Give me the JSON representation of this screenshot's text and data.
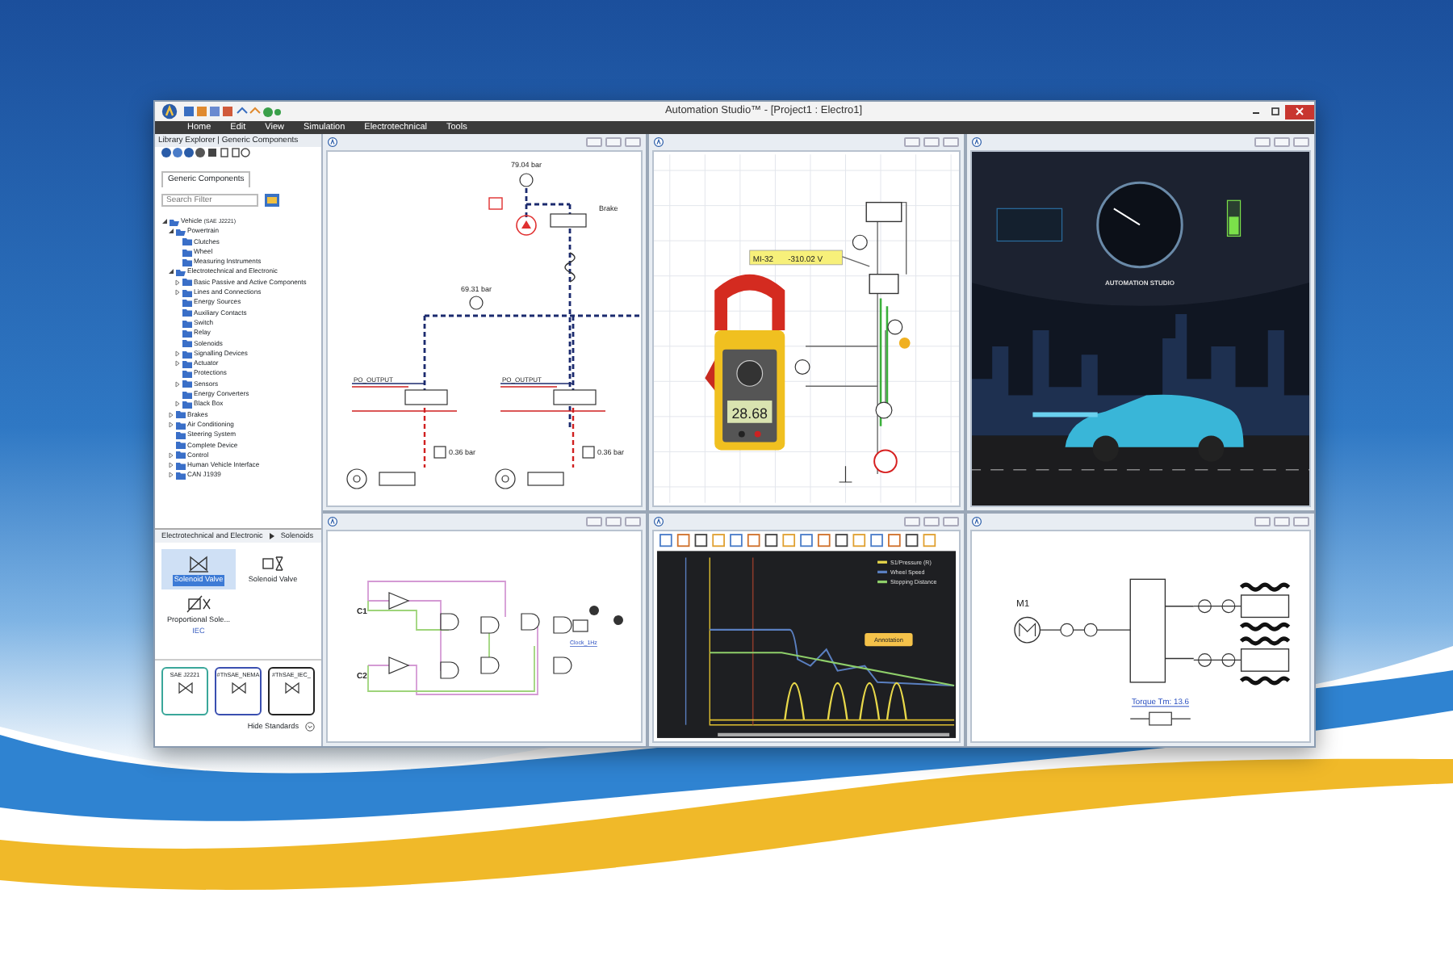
{
  "window": {
    "title": "Automation Studio™ - [Project1 : Electro1]"
  },
  "menu": [
    "Home",
    "Edit",
    "View",
    "Simulation",
    "Electrotechnical",
    "Tools"
  ],
  "library": {
    "title": "Library Explorer | Generic Components",
    "tab": "Generic Components",
    "search": {
      "placeholder": "Search Filter"
    },
    "tree": [
      {
        "label": "Vehicle",
        "note": "(SAE J2221)",
        "expanded": true,
        "children": [
          {
            "label": "Powertrain",
            "expanded": true,
            "children": [
              {
                "label": "Clutches"
              },
              {
                "label": "Wheel"
              },
              {
                "label": "Measuring Instruments"
              }
            ]
          },
          {
            "label": "Electrotechnical and Electronic",
            "expanded": true,
            "children": [
              {
                "label": "Basic Passive and Active Components",
                "expanded": false
              },
              {
                "label": "Lines and Connections",
                "expanded": false
              },
              {
                "label": "Energy Sources"
              },
              {
                "label": "Auxiliary Contacts"
              },
              {
                "label": "Switch"
              },
              {
                "label": "Relay"
              },
              {
                "label": "Solenoids"
              },
              {
                "label": "Signalling Devices",
                "expanded": false
              },
              {
                "label": "Actuator",
                "expanded": false
              },
              {
                "label": "Protections"
              },
              {
                "label": "Sensors",
                "expanded": false
              },
              {
                "label": "Energy Converters"
              },
              {
                "label": "Black Box",
                "expanded": false
              }
            ]
          },
          {
            "label": "Brakes",
            "expanded": false
          },
          {
            "label": "Air Conditioning",
            "expanded": false
          },
          {
            "label": "Steering System"
          },
          {
            "label": "Complete Device"
          },
          {
            "label": "Control",
            "expanded": false
          },
          {
            "label": "Human Vehicle Interface",
            "expanded": false
          },
          {
            "label": "CAN J1939",
            "expanded": false
          }
        ]
      }
    ],
    "breadcrumb": [
      "Electrotechnical and Electronic",
      "Solenoids"
    ],
    "components": [
      {
        "label": "Solenoid Valve",
        "selected": true
      },
      {
        "label": "Solenoid Valve",
        "selected": false
      },
      {
        "label": "Proportional Sole...",
        "standard": "IEC",
        "selected": false
      }
    ],
    "standards": [
      {
        "label": "SAE J2221",
        "color": "#3aa79a"
      },
      {
        "label": "#ThSAE_NEMA",
        "color": "#3a4fb0"
      },
      {
        "label": "#ThSAE_IEC_",
        "color": "#222222"
      }
    ],
    "hide_standards": "Hide Standards"
  },
  "panels": [
    {
      "kind": "hydraulic",
      "gauges": [
        "79.04 bar",
        "69.31 bar"
      ],
      "valve_label": "Brake",
      "outputs": [
        "PO_OUTPUT",
        "PO_OUTPUT"
      ],
      "pressures": [
        "0.36 bar",
        "0.36 bar"
      ]
    },
    {
      "kind": "multimeter",
      "probe": {
        "name": "MI-32",
        "reading": "-310.02 V"
      },
      "display": "28.68"
    },
    {
      "kind": "dashboard",
      "brand": "AUTOMATION STUDIO"
    },
    {
      "kind": "logic",
      "inputs": [
        "C1",
        "C2"
      ],
      "output_label": "Clock_1Hz"
    },
    {
      "kind": "chart",
      "legend": [
        {
          "label": "S1/Pressure (R)",
          "color": "#e8d84a"
        },
        {
          "label": "Wheel Speed",
          "color": "#5a7fc0"
        },
        {
          "label": "Stopping Distance",
          "color": "#8fcf6a"
        }
      ],
      "annotation": "Annotation"
    },
    {
      "kind": "motor",
      "motor_label": "M1",
      "torque": "Torque Tm: 13.6"
    }
  ]
}
